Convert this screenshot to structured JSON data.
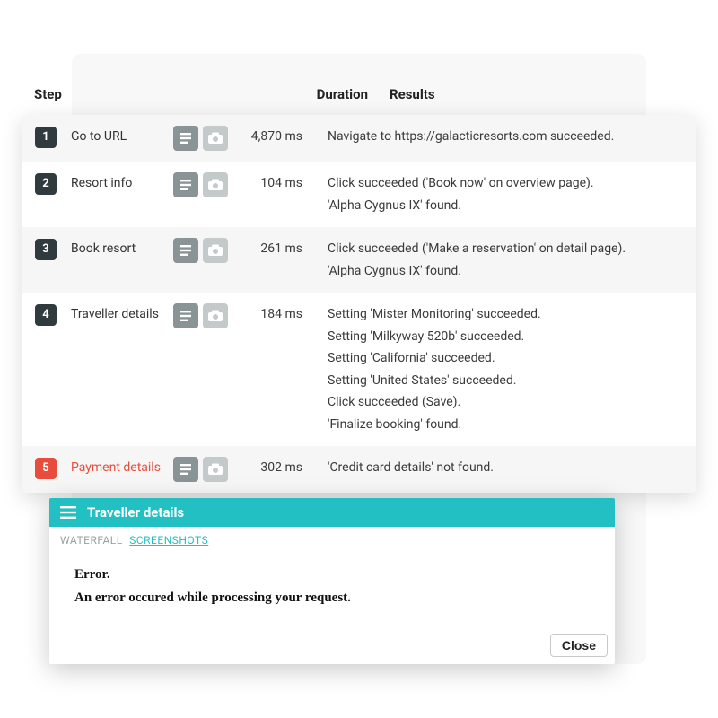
{
  "headers": {
    "step": "Step",
    "duration": "Duration",
    "results": "Results"
  },
  "steps": [
    {
      "num": "1",
      "name": "Go to URL",
      "duration": "4,870 ms",
      "error": false,
      "results": [
        "Navigate to https://galacticresorts.com succeeded."
      ]
    },
    {
      "num": "2",
      "name": "Resort info",
      "duration": "104 ms",
      "error": false,
      "results": [
        "Click succeeded ('Book now' on overview page).",
        "'Alpha Cygnus IX' found."
      ]
    },
    {
      "num": "3",
      "name": "Book resort",
      "duration": "261 ms",
      "error": false,
      "results": [
        "Click succeeded ('Make a reservation' on detail page).",
        "'Alpha Cygnus IX' found."
      ]
    },
    {
      "num": "4",
      "name": "Traveller details",
      "duration": "184 ms",
      "error": false,
      "results": [
        "Setting 'Mister Monitoring' succeeded.",
        "Setting 'Milkyway 520b' succeeded.",
        "Setting 'California' succeeded.",
        "Setting 'United States' succeeded.",
        "Click succeeded (Save).",
        "'Finalize booking' found."
      ]
    },
    {
      "num": "5",
      "name": "Payment details",
      "duration": "302 ms",
      "error": true,
      "results": [
        "'Credit card details' not found."
      ]
    }
  ],
  "popup": {
    "title": "Traveller details",
    "tab_waterfall": "WATERFALL",
    "tab_screenshots": "SCREENSHOTS",
    "error_title": "Error.",
    "error_message": "An error occured while processing your request.",
    "close_label": "Close"
  }
}
